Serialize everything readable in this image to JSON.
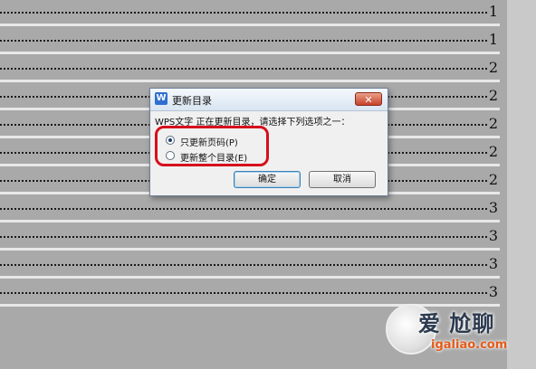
{
  "toc_page_numbers": [
    "1",
    "1",
    "2",
    "2",
    "2",
    "2",
    "2",
    "3",
    "3",
    "3",
    "3"
  ],
  "dialog": {
    "title": "更新目录",
    "app_icon_glyph": "W",
    "close_glyph": "✕",
    "prompt": "WPS文字 正在更新目录，请选择下列选项之一：",
    "options": [
      {
        "label": "只更新页码(P)",
        "selected": true
      },
      {
        "label": "更新整个目录(E)",
        "selected": false
      }
    ],
    "ok_label": "确定",
    "cancel_label": "取消"
  },
  "watermark": {
    "text": "爱 尬聊",
    "url": "igaliao.com"
  },
  "colors": {
    "highlight": "#d6101c",
    "background": "#a9a9a9"
  }
}
